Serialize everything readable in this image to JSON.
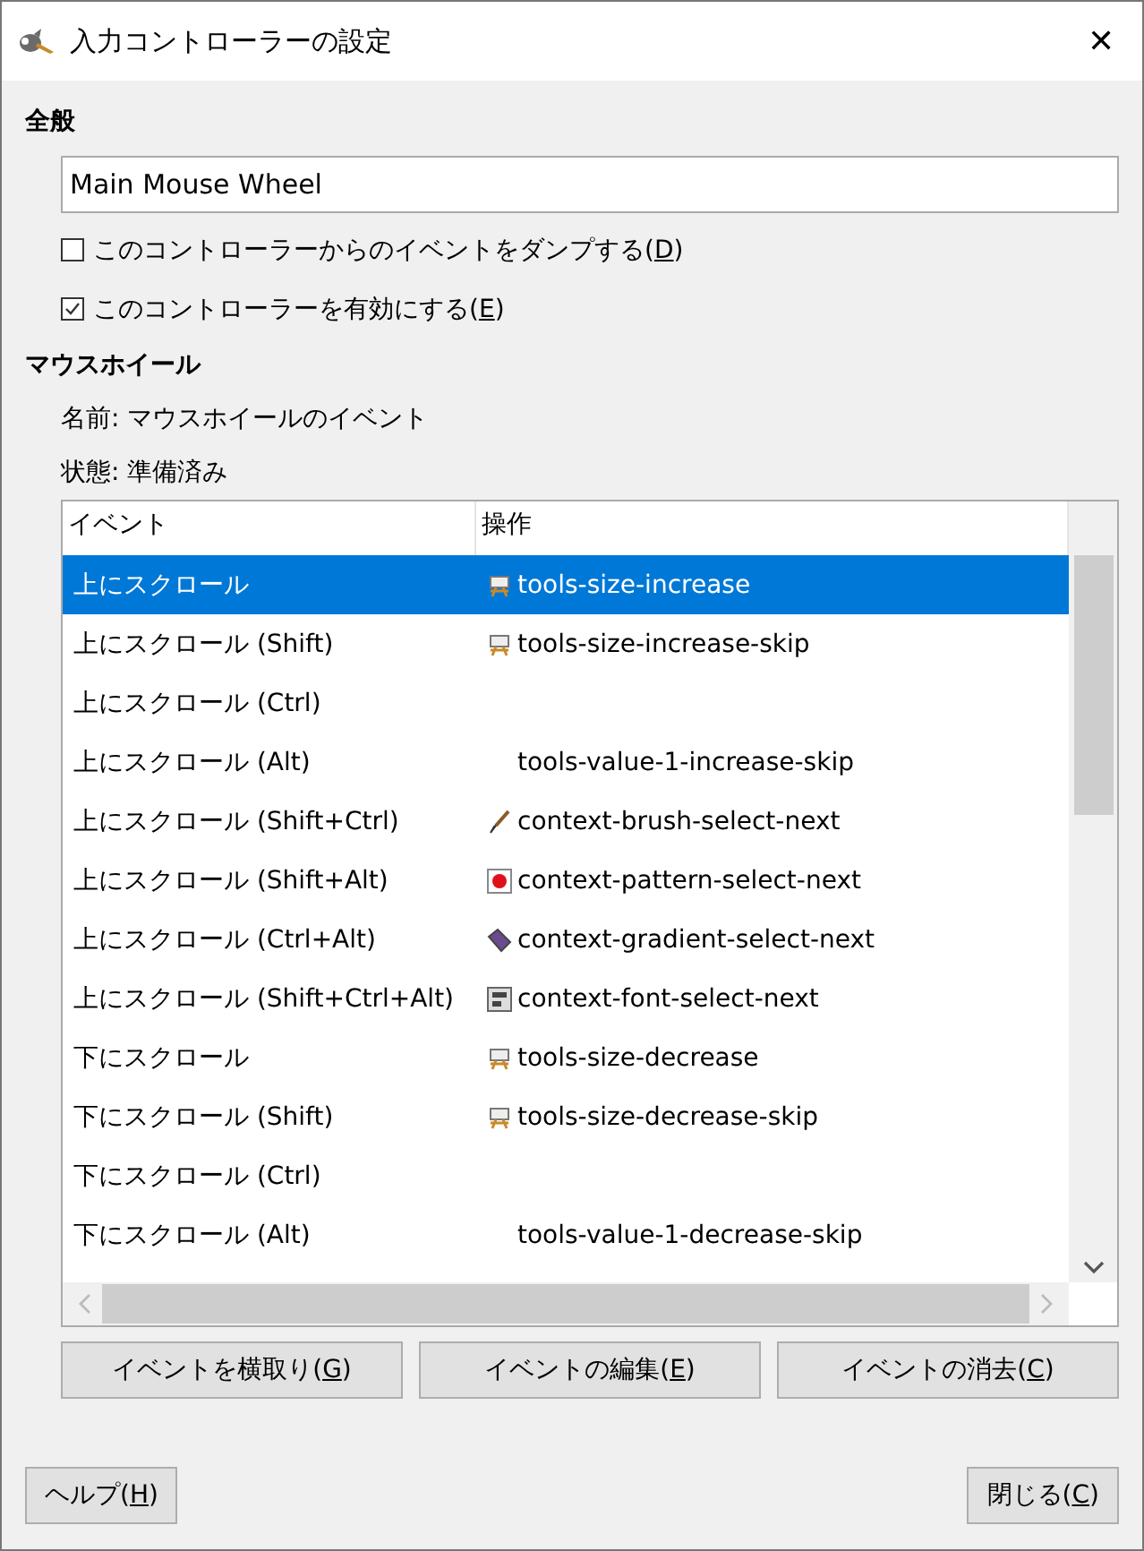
{
  "window": {
    "title": "入力コントローラーの設定",
    "close": "✕"
  },
  "general": {
    "heading": "全般",
    "name_value": "Main Mouse Wheel",
    "options": [
      {
        "label": "このコントローラーからのイベントをダンプする(D)",
        "checked": false
      },
      {
        "label": "このコントローラーを有効にする(E)",
        "checked": true
      }
    ]
  },
  "mouse_wheel": {
    "heading": "マウスホイール",
    "name_line": "名前: マウスホイールのイベント",
    "state_line": "状態: 準備済み"
  },
  "table": {
    "columns": [
      "イベント",
      "操作"
    ],
    "rows": [
      {
        "event": "上にスクロール",
        "action": "tools-size-increase",
        "kind": "easel",
        "selected": true
      },
      {
        "event": "上にスクロール (Shift)",
        "action": "tools-size-increase-skip",
        "kind": "easel",
        "selected": false
      },
      {
        "event": "上にスクロール (Ctrl)",
        "kind": "empty",
        "selected": false
      },
      {
        "event": "上にスクロール (Alt)",
        "action": "tools-value-1-increase-skip",
        "kind": "plain",
        "selected": false
      },
      {
        "event": "上にスクロール (Shift+Ctrl)",
        "action": "context-brush-select-next",
        "kind": "brush",
        "selected": false
      },
      {
        "event": "上にスクロール (Shift+Alt)",
        "action": "context-pattern-select-next",
        "kind": "pattern",
        "selected": false
      },
      {
        "event": "上にスクロール (Ctrl+Alt)",
        "action": "context-gradient-select-next",
        "kind": "gradient",
        "selected": false
      },
      {
        "event": "上にスクロール (Shift+Ctrl+Alt)",
        "action": "context-font-select-next",
        "kind": "font",
        "selected": false
      },
      {
        "event": "下にスクロール",
        "action": "tools-size-decrease",
        "kind": "easel",
        "selected": false
      },
      {
        "event": "下にスクロール (Shift)",
        "action": "tools-size-decrease-skip",
        "kind": "easel",
        "selected": false
      },
      {
        "event": "下にスクロール (Ctrl)",
        "kind": "empty",
        "selected": false
      },
      {
        "event": "下にスクロール (Alt)",
        "action": "tools-value-1-decrease-skip",
        "kind": "plain",
        "selected": false
      }
    ]
  },
  "table_buttons": [
    "イベントを横取り(G)",
    "イベントの編集(E)",
    "イベントの消去(C)"
  ],
  "footer": {
    "help": "ヘルプ(H)",
    "close": "閉じる(C)"
  }
}
